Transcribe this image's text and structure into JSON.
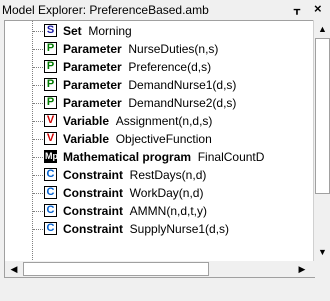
{
  "panel": {
    "title": "Model Explorer: PreferenceBased.amb",
    "pin_glyph": "\u0004",
    "close_glyph": "×"
  },
  "tree": {
    "items": [
      {
        "icon": "S",
        "icon_class": "set",
        "icon_name": "set-icon",
        "type": "Set",
        "name": "Morning"
      },
      {
        "icon": "P",
        "icon_class": "par",
        "icon_name": "parameter-icon",
        "type": "Parameter",
        "name": "NurseDuties(n,s)"
      },
      {
        "icon": "P",
        "icon_class": "par",
        "icon_name": "parameter-icon",
        "type": "Parameter",
        "name": "Preference(d,s)"
      },
      {
        "icon": "P",
        "icon_class": "par",
        "icon_name": "parameter-icon",
        "type": "Parameter",
        "name": "DemandNurse1(d,s)"
      },
      {
        "icon": "P",
        "icon_class": "par",
        "icon_name": "parameter-icon",
        "type": "Parameter",
        "name": "DemandNurse2(d,s)"
      },
      {
        "icon": "V",
        "icon_class": "var",
        "icon_name": "variable-icon",
        "type": "Variable",
        "name": "Assignment(n,d,s)"
      },
      {
        "icon": "V",
        "icon_class": "var",
        "icon_name": "variable-icon",
        "type": "Variable",
        "name": "ObjectiveFunction"
      },
      {
        "icon": "Mp",
        "icon_class": "math",
        "icon_name": "mathematical-program-icon",
        "type": "Mathematical program",
        "name": "FinalCountD"
      },
      {
        "icon": "C",
        "icon_class": "cons",
        "icon_name": "constraint-icon",
        "type": "Constraint",
        "name": "RestDays(n,d)"
      },
      {
        "icon": "C",
        "icon_class": "cons",
        "icon_name": "constraint-icon",
        "type": "Constraint",
        "name": "WorkDay(n,d)"
      },
      {
        "icon": "C",
        "icon_class": "cons",
        "icon_name": "constraint-icon",
        "type": "Constraint",
        "name": "AMMN(n,d,t,y)"
      },
      {
        "icon": "C",
        "icon_class": "cons",
        "icon_name": "constraint-icon",
        "type": "Constraint",
        "name": "SupplyNurse1(d,s)"
      }
    ]
  },
  "scrollbars": {
    "up_arrow": "▲",
    "down_arrow": "▼",
    "left_arrow": "◀",
    "right_arrow": "▶"
  }
}
